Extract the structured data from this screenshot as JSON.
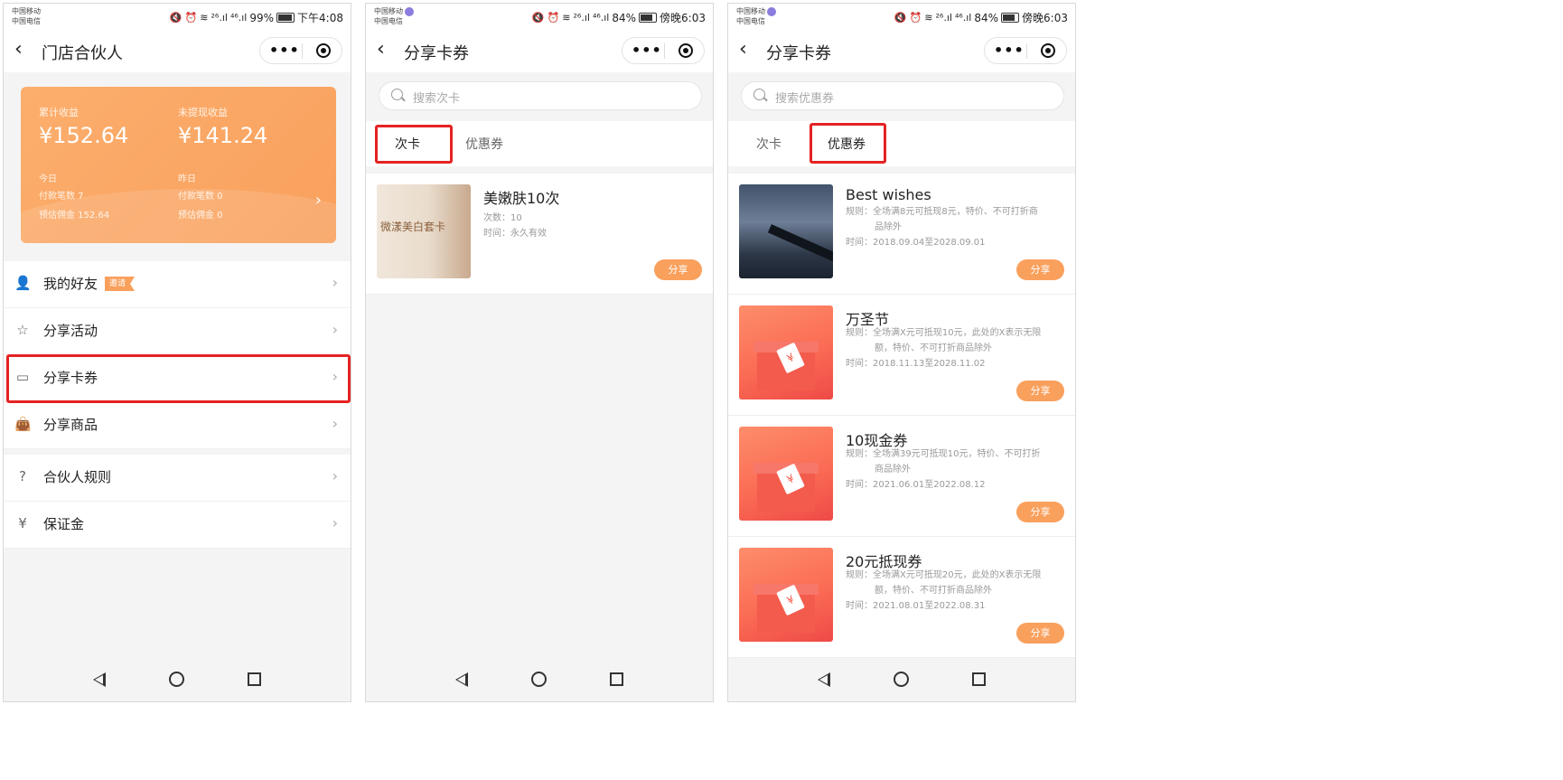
{
  "panel1": {
    "status": {
      "carrier1": "中国移动",
      "carrier2": "中国电信",
      "signal_a": "²⁶.ıl",
      "signal_b": "⁴⁶.ıl",
      "battery": "99%",
      "time": "下午4:08"
    },
    "nav": {
      "title": "门店合伙人"
    },
    "earnings": {
      "total_label": "累计收益",
      "total_value": "¥152.64",
      "unwithdrawn_label": "未提现收益",
      "unwithdrawn_value": "¥141.24",
      "today": {
        "label": "今日",
        "orders": "付款笔数 7",
        "commission": "预估佣金 152.64"
      },
      "yesterday": {
        "label": "昨日",
        "orders": "付款笔数 0",
        "commission": "预估佣金 0"
      }
    },
    "menu": [
      {
        "label": "我的好友",
        "tag": "邀请",
        "icon": "user-icon"
      },
      {
        "label": "分享活动",
        "icon": "star-icon"
      },
      {
        "label": "分享卡券",
        "icon": "card-icon"
      },
      {
        "label": "分享商品",
        "icon": "bag-icon"
      }
    ],
    "menu2": [
      {
        "label": "合伙人规则",
        "icon": "question-icon"
      },
      {
        "label": "保证金",
        "icon": "shield-icon"
      }
    ]
  },
  "panel2": {
    "status": {
      "carrier1": "中国移动",
      "carrier2": "中国电信",
      "signal_a": "²⁶.ıl",
      "signal_b": "⁴⁶.ıl",
      "battery": "84%",
      "time": "傍晚6:03"
    },
    "nav": {
      "title": "分享卡券"
    },
    "search_placeholder": "搜索次卡",
    "tabs": [
      "次卡",
      "优惠券"
    ],
    "active_tab": "次卡",
    "items": [
      {
        "title": "美嫩肤10次",
        "count": "次数：10",
        "time": "时间：永久有效",
        "thumb_text": "微漾美白套卡",
        "button": "分享"
      }
    ]
  },
  "panel3": {
    "status": {
      "carrier1": "中国移动",
      "carrier2": "中国电信",
      "signal_a": "²⁶.ıl",
      "signal_b": "⁴⁶.ıl",
      "battery": "84%",
      "time": "傍晚6:03"
    },
    "nav": {
      "title": "分享卡券"
    },
    "search_placeholder": "搜索优惠券",
    "tabs": [
      "次卡",
      "优惠券"
    ],
    "active_tab": "优惠券",
    "items": [
      {
        "title": "Best wishes",
        "rule1": "规则：全场满8元可抵现8元，特价、不可打折商",
        "rule2": "品除外",
        "time": "时间：2018.09.04至2028.09.01",
        "button": "分享"
      },
      {
        "title": "万圣节",
        "rule1": "规则：全场满X元可抵现10元，此处的X表示无限",
        "rule2": "额，特价、不可打折商品除外",
        "time": "时间：2018.11.13至2028.11.02",
        "button": "分享"
      },
      {
        "title": "10现金券",
        "rule1": "规则：全场满39元可抵现10元，特价、不可打折",
        "rule2": "商品除外",
        "time": "时间：2021.06.01至2022.08.12",
        "button": "分享"
      },
      {
        "title": "20元抵现券",
        "rule1": "规则：全场满X元可抵现20元，此处的X表示无限",
        "rule2": "额，特价、不可打折商品除外",
        "time": "时间：2021.08.01至2022.08.31",
        "button": "分享"
      }
    ]
  },
  "colors": {
    "accent": "#f9a05d",
    "highlight": "#e52222",
    "background": "#f4f4f4"
  }
}
